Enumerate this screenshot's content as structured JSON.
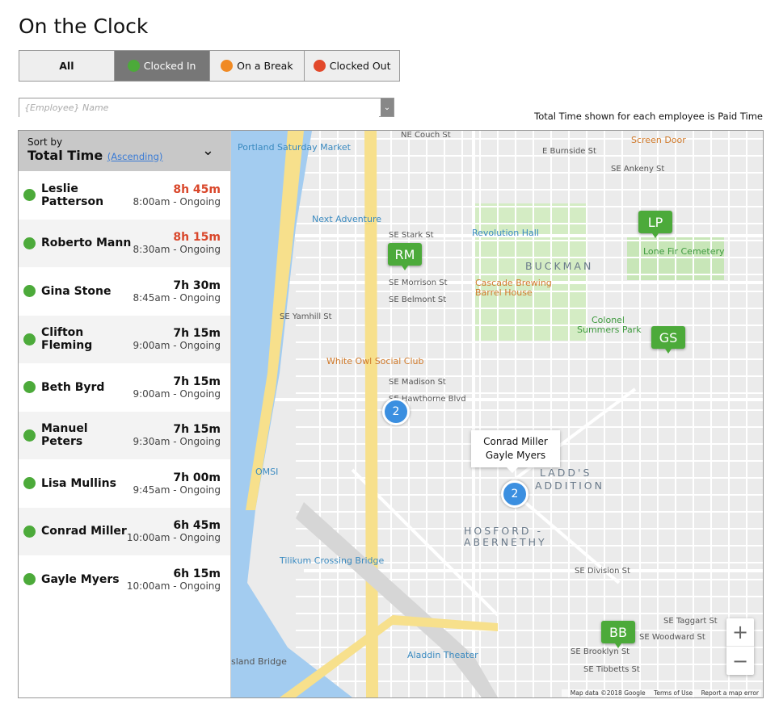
{
  "title": "On the Clock",
  "filters": [
    {
      "label": "All",
      "dot": null,
      "active": false
    },
    {
      "label": "Clocked In",
      "dot": "#4caa3a",
      "active": true
    },
    {
      "label": "On a Break",
      "dot": "#f08a24",
      "active": false
    },
    {
      "label": "Clocked Out",
      "dot": "#e2492b",
      "active": false
    }
  ],
  "search": {
    "placeholder": "{Employee} Name",
    "value": ""
  },
  "note": "Total Time shown for each employee is Paid Time",
  "sort": {
    "label": "Sort by",
    "field": "Total Time",
    "order": "(Ascending)"
  },
  "colors": {
    "clocked_in": "#4caa3a",
    "overtime": "#d9472b",
    "cluster": "#3b8fe0"
  },
  "employees": [
    {
      "name": "Leslie Patterson",
      "total": "8h 45m",
      "span": "8:00am - Ongoing",
      "overtime": true
    },
    {
      "name": "Roberto Mann",
      "total": "8h 15m",
      "span": "8:30am - Ongoing",
      "overtime": true
    },
    {
      "name": "Gina Stone",
      "total": "7h 30m",
      "span": "8:45am - Ongoing",
      "overtime": false
    },
    {
      "name": "Clifton Fleming",
      "total": "7h 15m",
      "span": "9:00am - Ongoing",
      "overtime": false
    },
    {
      "name": "Beth Byrd",
      "total": "7h 15m",
      "span": "9:00am - Ongoing",
      "overtime": false
    },
    {
      "name": "Manuel Peters",
      "total": "7h 15m",
      "span": "9:30am - Ongoing",
      "overtime": false
    },
    {
      "name": "Lisa Mullins",
      "total": "7h 00m",
      "span": "9:45am - Ongoing",
      "overtime": false
    },
    {
      "name": "Conrad Miller",
      "total": "6h 45m",
      "span": "10:00am - Ongoing",
      "overtime": false
    },
    {
      "name": "Gayle Myers",
      "total": "6h 15m",
      "span": "10:00am - Ongoing",
      "overtime": false
    }
  ],
  "map": {
    "markers": [
      "RM",
      "LP",
      "GS",
      "BB"
    ],
    "clusters": [
      "2",
      "2"
    ],
    "tooltip": [
      "Conrad Miller",
      "Gayle Myers"
    ],
    "zoom_in": "+",
    "zoom_out": "−",
    "attribution": [
      "Map data ©2018 Google",
      "Terms of Use",
      "Report a map error"
    ],
    "labels": {
      "portland_saturday_market": "Portland Saturday Market",
      "next_adventure": "Next Adventure",
      "revolution_hall": "Revolution Hall",
      "cascade": "Cascade Brewing",
      "cascade2": "Barrel House",
      "white_owl": "White Owl Social Club",
      "screen_door": "Screen Door",
      "lone_fir": "Lone Fir Cemetery",
      "colonel": "Colonel",
      "colonel2": "Summers Park",
      "buckman": "BUCKMAN",
      "ladds": "LADD'S",
      "ladds2": "ADDITION",
      "hosford": "HOSFORD -",
      "hosford2": "ABERNETHY",
      "omsi": "OMSI",
      "tilikum": "Tilikum Crossing Bridge",
      "aladdin": "Aladdin Theater",
      "ross_island": "sland Bridge",
      "stark": "SE Stark St",
      "morrison": "SE Morrison St",
      "belmont": "SE Belmont St",
      "hawthorne": "SE Hawthorne Blvd",
      "madison": "SE Madison St",
      "division": "SE Division St",
      "burnside": "E Burnside St",
      "woodward": "SE Woodward St",
      "taggart": "SE Taggart St",
      "brooklyn": "SE Brooklyn St",
      "tibbetts": "SE Tibbetts St",
      "yamhill": "SE Yamhill St",
      "couch": "NE Couch St",
      "ankeny": "SE Ankeny St"
    }
  }
}
